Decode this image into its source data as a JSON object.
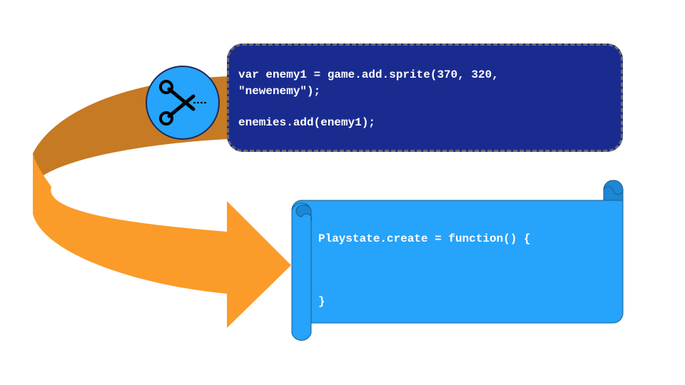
{
  "snippet": {
    "line1": "var enemy1 = game.add.sprite(370, 320,",
    "line2": "\"newenemy\");",
    "line3": "enemies.add(enemy1);"
  },
  "scroll": {
    "line1": "Playstate.create = function() {",
    "line2": "}"
  },
  "icons": {
    "cut": "scissors-icon",
    "arrow": "curved-arrow"
  },
  "colors": {
    "arrow_dark": "#c67a24",
    "arrow_light": "#fb9b29",
    "code_box_bg": "#1a2b8f",
    "code_box_border": "#6b6b6b",
    "scroll_fill": "#26a3fb",
    "scissors_circle": "#26a3fb",
    "text": "#ffffff"
  }
}
